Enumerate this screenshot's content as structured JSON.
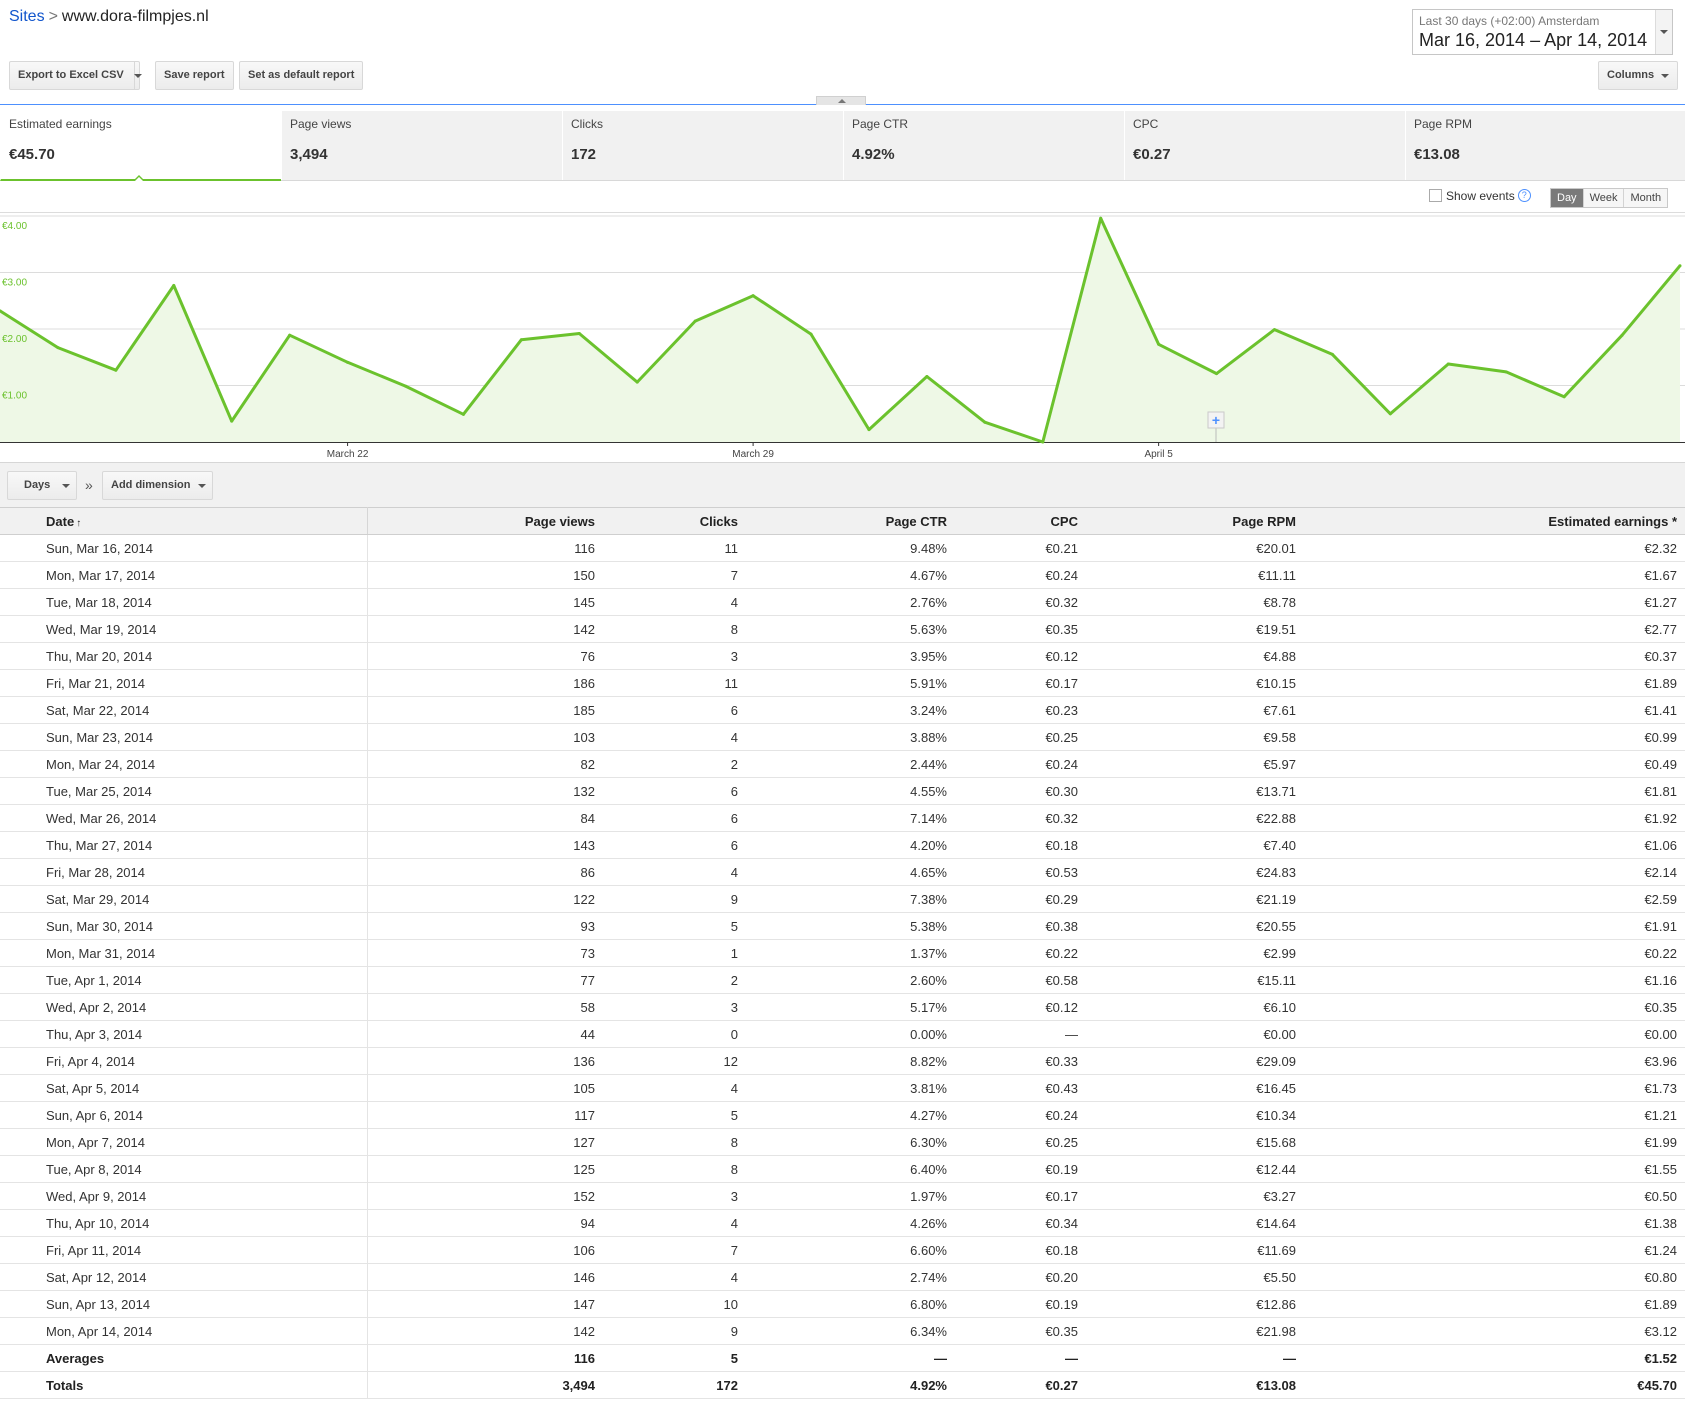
{
  "breadcrumb": {
    "root": "Sites",
    "separator": ">",
    "current": "www.dora-filmpjes.nl"
  },
  "date_range": {
    "label": "Last 30 days (+02:00) Amsterdam",
    "value": "Mar 16, 2014 – Apr 14, 2014"
  },
  "toolbar": {
    "export_label": "Export to Excel CSV",
    "save_label": "Save report",
    "default_label": "Set as default report",
    "columns_label": "Columns"
  },
  "scorecards": [
    {
      "label": "Estimated earnings",
      "value": "€45.70"
    },
    {
      "label": "Page views",
      "value": "3,494"
    },
    {
      "label": "Clicks",
      "value": "172"
    },
    {
      "label": "Page CTR",
      "value": "4.92%"
    },
    {
      "label": "CPC",
      "value": "€0.27"
    },
    {
      "label": "Page RPM",
      "value": "€13.08"
    }
  ],
  "chart_controls": {
    "show_events": "Show events",
    "help": "?",
    "granularity": [
      "Day",
      "Week",
      "Month"
    ],
    "selected": "Day"
  },
  "chart_data": {
    "type": "area",
    "x": [
      "Mar 16",
      "Mar 17",
      "Mar 18",
      "Mar 19",
      "Mar 20",
      "Mar 21",
      "Mar 22",
      "Mar 23",
      "Mar 24",
      "Mar 25",
      "Mar 26",
      "Mar 27",
      "Mar 28",
      "Mar 29",
      "Mar 30",
      "Mar 31",
      "Apr 1",
      "Apr 2",
      "Apr 3",
      "Apr 4",
      "Apr 5",
      "Apr 6",
      "Apr 7",
      "Apr 8",
      "Apr 9",
      "Apr 10",
      "Apr 11",
      "Apr 12",
      "Apr 13",
      "Apr 14"
    ],
    "series": [
      {
        "values": [
          2.32,
          1.67,
          1.27,
          2.77,
          0.37,
          1.89,
          1.41,
          0.99,
          0.49,
          1.81,
          1.92,
          1.06,
          2.14,
          2.59,
          1.91,
          0.22,
          1.16,
          0.35,
          0.0,
          3.96,
          1.73,
          1.21,
          1.99,
          1.55,
          0.5,
          1.38,
          1.24,
          0.8,
          1.89,
          3.12
        ]
      }
    ],
    "y_ticks": [
      "€4.00",
      "€3.00",
      "€2.00",
      "€1.00"
    ],
    "x_ticks": [
      {
        "label": "March 22",
        "index": 6
      },
      {
        "label": "March 29",
        "index": 13
      },
      {
        "label": "April 5",
        "index": 20
      }
    ],
    "ylim": [
      0,
      4
    ],
    "grid": true,
    "line_color": "#6bc22d",
    "fill_color": "#eef8e6",
    "event_marker": "+"
  },
  "dimension": {
    "selected": "Days",
    "separator": "»",
    "add_label": "Add dimension"
  },
  "table": {
    "columns": [
      "Date",
      "Page views",
      "Clicks",
      "Page CTR",
      "CPC",
      "Page RPM",
      "Estimated earnings"
    ],
    "sort_indicator": "↑",
    "earnings_note": "*",
    "rows": [
      [
        "Sun, Mar 16, 2014",
        "116",
        "11",
        "9.48%",
        "€0.21",
        "€20.01",
        "€2.32"
      ],
      [
        "Mon, Mar 17, 2014",
        "150",
        "7",
        "4.67%",
        "€0.24",
        "€11.11",
        "€1.67"
      ],
      [
        "Tue, Mar 18, 2014",
        "145",
        "4",
        "2.76%",
        "€0.32",
        "€8.78",
        "€1.27"
      ],
      [
        "Wed, Mar 19, 2014",
        "142",
        "8",
        "5.63%",
        "€0.35",
        "€19.51",
        "€2.77"
      ],
      [
        "Thu, Mar 20, 2014",
        "76",
        "3",
        "3.95%",
        "€0.12",
        "€4.88",
        "€0.37"
      ],
      [
        "Fri, Mar 21, 2014",
        "186",
        "11",
        "5.91%",
        "€0.17",
        "€10.15",
        "€1.89"
      ],
      [
        "Sat, Mar 22, 2014",
        "185",
        "6",
        "3.24%",
        "€0.23",
        "€7.61",
        "€1.41"
      ],
      [
        "Sun, Mar 23, 2014",
        "103",
        "4",
        "3.88%",
        "€0.25",
        "€9.58",
        "€0.99"
      ],
      [
        "Mon, Mar 24, 2014",
        "82",
        "2",
        "2.44%",
        "€0.24",
        "€5.97",
        "€0.49"
      ],
      [
        "Tue, Mar 25, 2014",
        "132",
        "6",
        "4.55%",
        "€0.30",
        "€13.71",
        "€1.81"
      ],
      [
        "Wed, Mar 26, 2014",
        "84",
        "6",
        "7.14%",
        "€0.32",
        "€22.88",
        "€1.92"
      ],
      [
        "Thu, Mar 27, 2014",
        "143",
        "6",
        "4.20%",
        "€0.18",
        "€7.40",
        "€1.06"
      ],
      [
        "Fri, Mar 28, 2014",
        "86",
        "4",
        "4.65%",
        "€0.53",
        "€24.83",
        "€2.14"
      ],
      [
        "Sat, Mar 29, 2014",
        "122",
        "9",
        "7.38%",
        "€0.29",
        "€21.19",
        "€2.59"
      ],
      [
        "Sun, Mar 30, 2014",
        "93",
        "5",
        "5.38%",
        "€0.38",
        "€20.55",
        "€1.91"
      ],
      [
        "Mon, Mar 31, 2014",
        "73",
        "1",
        "1.37%",
        "€0.22",
        "€2.99",
        "€0.22"
      ],
      [
        "Tue, Apr 1, 2014",
        "77",
        "2",
        "2.60%",
        "€0.58",
        "€15.11",
        "€1.16"
      ],
      [
        "Wed, Apr 2, 2014",
        "58",
        "3",
        "5.17%",
        "€0.12",
        "€6.10",
        "€0.35"
      ],
      [
        "Thu, Apr 3, 2014",
        "44",
        "0",
        "0.00%",
        "—",
        "€0.00",
        "€0.00"
      ],
      [
        "Fri, Apr 4, 2014",
        "136",
        "12",
        "8.82%",
        "€0.33",
        "€29.09",
        "€3.96"
      ],
      [
        "Sat, Apr 5, 2014",
        "105",
        "4",
        "3.81%",
        "€0.43",
        "€16.45",
        "€1.73"
      ],
      [
        "Sun, Apr 6, 2014",
        "117",
        "5",
        "4.27%",
        "€0.24",
        "€10.34",
        "€1.21"
      ],
      [
        "Mon, Apr 7, 2014",
        "127",
        "8",
        "6.30%",
        "€0.25",
        "€15.68",
        "€1.99"
      ],
      [
        "Tue, Apr 8, 2014",
        "125",
        "8",
        "6.40%",
        "€0.19",
        "€12.44",
        "€1.55"
      ],
      [
        "Wed, Apr 9, 2014",
        "152",
        "3",
        "1.97%",
        "€0.17",
        "€3.27",
        "€0.50"
      ],
      [
        "Thu, Apr 10, 2014",
        "94",
        "4",
        "4.26%",
        "€0.34",
        "€14.64",
        "€1.38"
      ],
      [
        "Fri, Apr 11, 2014",
        "106",
        "7",
        "6.60%",
        "€0.18",
        "€11.69",
        "€1.24"
      ],
      [
        "Sat, Apr 12, 2014",
        "146",
        "4",
        "2.74%",
        "€0.20",
        "€5.50",
        "€0.80"
      ],
      [
        "Sun, Apr 13, 2014",
        "147",
        "10",
        "6.80%",
        "€0.19",
        "€12.86",
        "€1.89"
      ],
      [
        "Mon, Apr 14, 2014",
        "142",
        "9",
        "6.34%",
        "€0.35",
        "€21.98",
        "€3.12"
      ]
    ],
    "averages": [
      "Averages",
      "116",
      "5",
      "—",
      "—",
      "—",
      "€1.52"
    ],
    "totals": [
      "Totals",
      "3,494",
      "172",
      "4.92%",
      "€0.27",
      "€13.08",
      "€45.70"
    ]
  }
}
